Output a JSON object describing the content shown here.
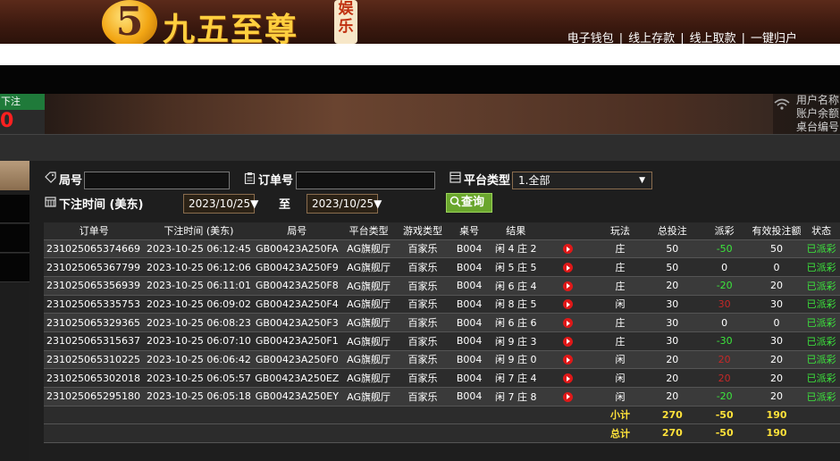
{
  "header": {
    "logo_digit": "5",
    "logo_text": "九五至尊",
    "logo_badge": "娱乐",
    "links": [
      "电子钱包",
      "线上存款",
      "线上取款",
      "一键归户"
    ],
    "separator": "|"
  },
  "video": {
    "bet_label": "下注",
    "bet_value": "0",
    "info_lines": [
      "用户名称",
      "账户余额",
      "桌台编号"
    ]
  },
  "filters": {
    "round_label": "局号",
    "round_value": "",
    "order_label": "订单号",
    "order_value": "",
    "platform_label": "平台类型",
    "platform_selected": "1.全部",
    "time_label": "下注时间 (美东)",
    "date_from": "2023/10/25",
    "date_to": "2023/10/25",
    "to_label": "至",
    "query_label": "查询"
  },
  "table": {
    "columns": [
      "订单号",
      "下注时间 (美东)",
      "局号",
      "平台类型",
      "游戏类型",
      "桌号",
      "结果",
      "",
      "玩法",
      "总投注",
      "派彩",
      "有效投注额",
      "状态"
    ],
    "rows": [
      {
        "order": "231025065374669",
        "time": "2023-10-25 06:12:45",
        "round": "GB00423A250FA",
        "platform": "AG旗舰厅",
        "game": "百家乐",
        "table": "B004",
        "result": "闲 4 庄 2",
        "play": "庄",
        "bet": "50",
        "payout": "-50",
        "payout_sign": "pos",
        "valid": "50",
        "status": "已派彩"
      },
      {
        "order": "231025065367799",
        "time": "2023-10-25 06:12:06",
        "round": "GB00423A250F9",
        "platform": "AG旗舰厅",
        "game": "百家乐",
        "table": "B004",
        "result": "闲 5 庄 5",
        "play": "庄",
        "bet": "50",
        "payout": "0",
        "payout_sign": "zero",
        "valid": "0",
        "status": "已派彩"
      },
      {
        "order": "231025065356939",
        "time": "2023-10-25 06:11:01",
        "round": "GB00423A250F8",
        "platform": "AG旗舰厅",
        "game": "百家乐",
        "table": "B004",
        "result": "闲 6 庄 4",
        "play": "庄",
        "bet": "20",
        "payout": "-20",
        "payout_sign": "pos",
        "valid": "20",
        "status": "已派彩"
      },
      {
        "order": "231025065335753",
        "time": "2023-10-25 06:09:02",
        "round": "GB00423A250F4",
        "platform": "AG旗舰厅",
        "game": "百家乐",
        "table": "B004",
        "result": "闲 8 庄 5",
        "play": "闲",
        "bet": "30",
        "payout": "30",
        "payout_sign": "neg",
        "valid": "30",
        "status": "已派彩"
      },
      {
        "order": "231025065329365",
        "time": "2023-10-25 06:08:23",
        "round": "GB00423A250F3",
        "platform": "AG旗舰厅",
        "game": "百家乐",
        "table": "B004",
        "result": "闲 6 庄 6",
        "play": "庄",
        "bet": "30",
        "payout": "0",
        "payout_sign": "zero",
        "valid": "0",
        "status": "已派彩"
      },
      {
        "order": "231025065315637",
        "time": "2023-10-25 06:07:10",
        "round": "GB00423A250F1",
        "platform": "AG旗舰厅",
        "game": "百家乐",
        "table": "B004",
        "result": "闲 9 庄 3",
        "play": "庄",
        "bet": "30",
        "payout": "-30",
        "payout_sign": "pos",
        "valid": "30",
        "status": "已派彩"
      },
      {
        "order": "231025065310225",
        "time": "2023-10-25 06:06:42",
        "round": "GB00423A250F0",
        "platform": "AG旗舰厅",
        "game": "百家乐",
        "table": "B004",
        "result": "闲 9 庄 0",
        "play": "闲",
        "bet": "20",
        "payout": "20",
        "payout_sign": "neg",
        "valid": "20",
        "status": "已派彩"
      },
      {
        "order": "231025065302018",
        "time": "2023-10-25 06:05:57",
        "round": "GB00423A250EZ",
        "platform": "AG旗舰厅",
        "game": "百家乐",
        "table": "B004",
        "result": "闲 7 庄 4",
        "play": "闲",
        "bet": "20",
        "payout": "20",
        "payout_sign": "neg",
        "valid": "20",
        "status": "已派彩"
      },
      {
        "order": "231025065295180",
        "time": "2023-10-25 06:05:18",
        "round": "GB00423A250EY",
        "platform": "AG旗舰厅",
        "game": "百家乐",
        "table": "B004",
        "result": "闲 7 庄 8",
        "play": "闲",
        "bet": "20",
        "payout": "-20",
        "payout_sign": "pos",
        "valid": "20",
        "status": "已派彩"
      }
    ],
    "subtotal": {
      "label": "小计",
      "bet": "270",
      "payout": "-50",
      "valid": "190"
    },
    "total": {
      "label": "总计",
      "bet": "270",
      "payout": "-50",
      "valid": "190"
    }
  },
  "colors": {
    "positive": "#3ce53c",
    "negative": "#c62828",
    "total": "#ffe23a",
    "query_button": "#6aa62d"
  }
}
